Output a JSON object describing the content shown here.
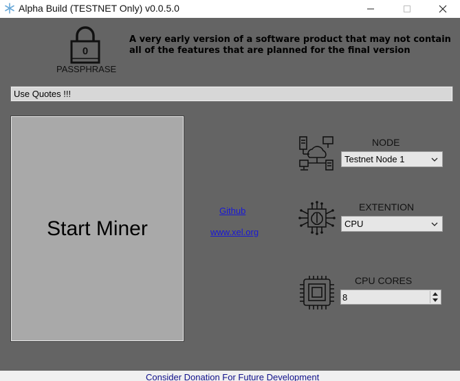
{
  "window": {
    "title": "Alpha Build (TESTNET Only) v0.0.5.0",
    "icon": "snowflake-app-icon"
  },
  "passphrase": {
    "lock_digit": "0",
    "label": "PASSPHRASE",
    "input_value": "Use Quotes !!!"
  },
  "description": "A very early version of a software product that may not contain all of the features that are planned for the final version",
  "start_button_label": "Start Miner",
  "links": {
    "github": "Github",
    "website": "www.xel.org"
  },
  "node": {
    "label": "NODE",
    "selected": "Testnet Node 1",
    "icon": "network-icon"
  },
  "extension": {
    "label": "EXTENTION",
    "selected": "CPU",
    "icon": "brain-chip-icon"
  },
  "cpu_cores": {
    "label": "CPU CORES",
    "value": "8",
    "icon": "cpu-chip-icon"
  },
  "footer": {
    "donation_text": "Consider Donation For Future Development"
  },
  "colors": {
    "background": "#646464",
    "start_button": "#a9a9a9",
    "link": "#1818d6",
    "footer_text": "#10108a"
  }
}
